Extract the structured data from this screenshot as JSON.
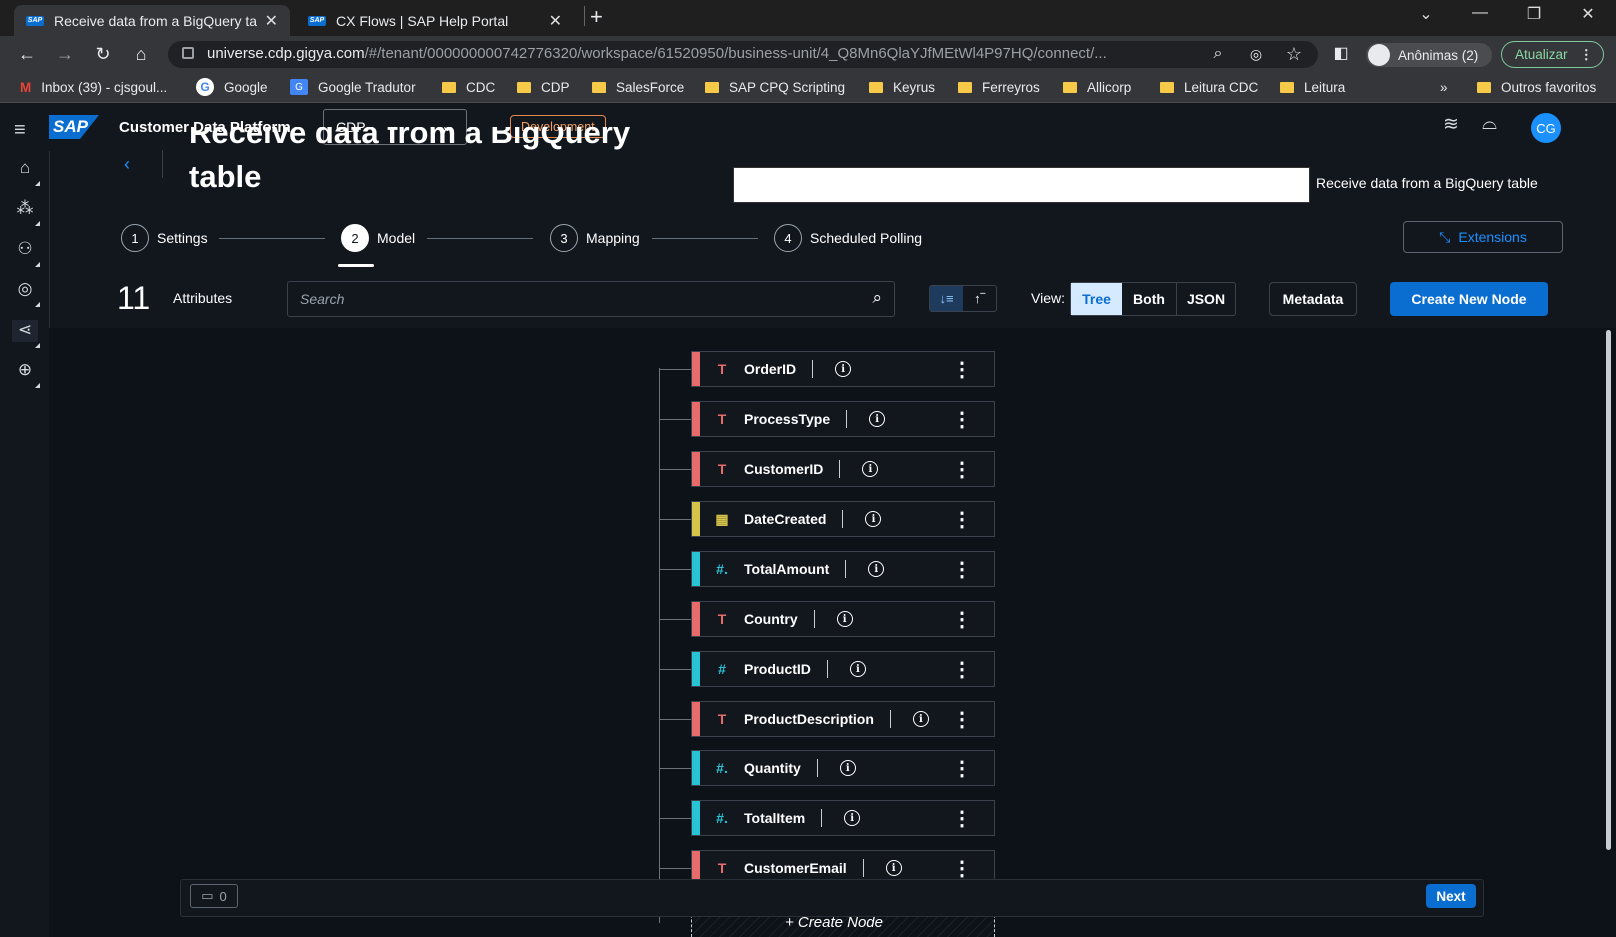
{
  "browser": {
    "tabs": [
      {
        "title": "Receive data from a BigQuery tab",
        "active": true
      },
      {
        "title": "CX Flows | SAP Help Portal",
        "active": false
      }
    ],
    "url_main": "universe.cdp.gigya.com",
    "url_rest": "/#/tenant/000000000742776320/workspace/61520950/business-unit/4_Q8Mn6QlaYJfMEtWl4P97HQ/connect/...",
    "profile_label": "Anônimas (2)",
    "update_label": "Atualizar",
    "bookmarks": [
      "Inbox (39) - cjsgoul...",
      "Google",
      "Google Tradutor",
      "CDC",
      "CDP",
      "SalesForce",
      "SAP CPQ Scripting",
      "Keyrus",
      "Ferreyros",
      "Allicorp",
      "Leitura CDC",
      "Leitura"
    ],
    "bookmarks_more": "»",
    "other_bookmarks": "Outros favoritos"
  },
  "shell": {
    "logo": "SAP",
    "product": "Customer Data Platform",
    "workspace": "CDP",
    "env_badge": "Development",
    "avatar": "CG"
  },
  "page": {
    "title_line1": "Receive data from a BigQuery",
    "title_line2": "table",
    "description": "Receive data from a BigQuery table",
    "extensions_label": "Extensions",
    "steps": [
      {
        "num": "1",
        "label": "Settings"
      },
      {
        "num": "2",
        "label": "Model"
      },
      {
        "num": "3",
        "label": "Mapping"
      },
      {
        "num": "4",
        "label": "Scheduled Polling"
      }
    ],
    "attr_count": "11",
    "attr_label": "Attributes",
    "search_placeholder": "Search",
    "view_label": "View:",
    "view_options": [
      "Tree",
      "Both",
      "JSON"
    ],
    "view_selected": "Tree",
    "metadata_label": "Metadata",
    "create_node_btn": "Create New Node",
    "create_node_link": "+ Create Node",
    "comment_count": "0",
    "next_label": "Next"
  },
  "nodes": [
    {
      "name": "OrderID",
      "type": "text",
      "icon": "T",
      "color": "#e86b6b"
    },
    {
      "name": "ProcessType",
      "type": "text",
      "icon": "T",
      "color": "#e86b6b"
    },
    {
      "name": "CustomerID",
      "type": "text",
      "icon": "T",
      "color": "#e86b6b"
    },
    {
      "name": "DateCreated",
      "type": "date",
      "icon": "calendar",
      "color": "#d8c34a"
    },
    {
      "name": "TotalAmount",
      "type": "float",
      "icon": "#.",
      "color": "#29c3d6"
    },
    {
      "name": "Country",
      "type": "text",
      "icon": "T",
      "color": "#e86b6b"
    },
    {
      "name": "ProductID",
      "type": "integer",
      "icon": "#",
      "color": "#29c3d6"
    },
    {
      "name": "ProductDescription",
      "type": "text",
      "icon": "T",
      "color": "#e86b6b"
    },
    {
      "name": "Quantity",
      "type": "float",
      "icon": "#.",
      "color": "#29c3d6"
    },
    {
      "name": "TotalItem",
      "type": "float",
      "icon": "#.",
      "color": "#29c3d6"
    },
    {
      "name": "CustomerEmail",
      "type": "text",
      "icon": "T",
      "color": "#e86b6b"
    }
  ],
  "colors": {
    "primary": "#0a6ed1",
    "accent": "#1b90ff",
    "text_type": "#e86b6b",
    "number_type": "#29c3d6",
    "date_type": "#d8c34a"
  }
}
